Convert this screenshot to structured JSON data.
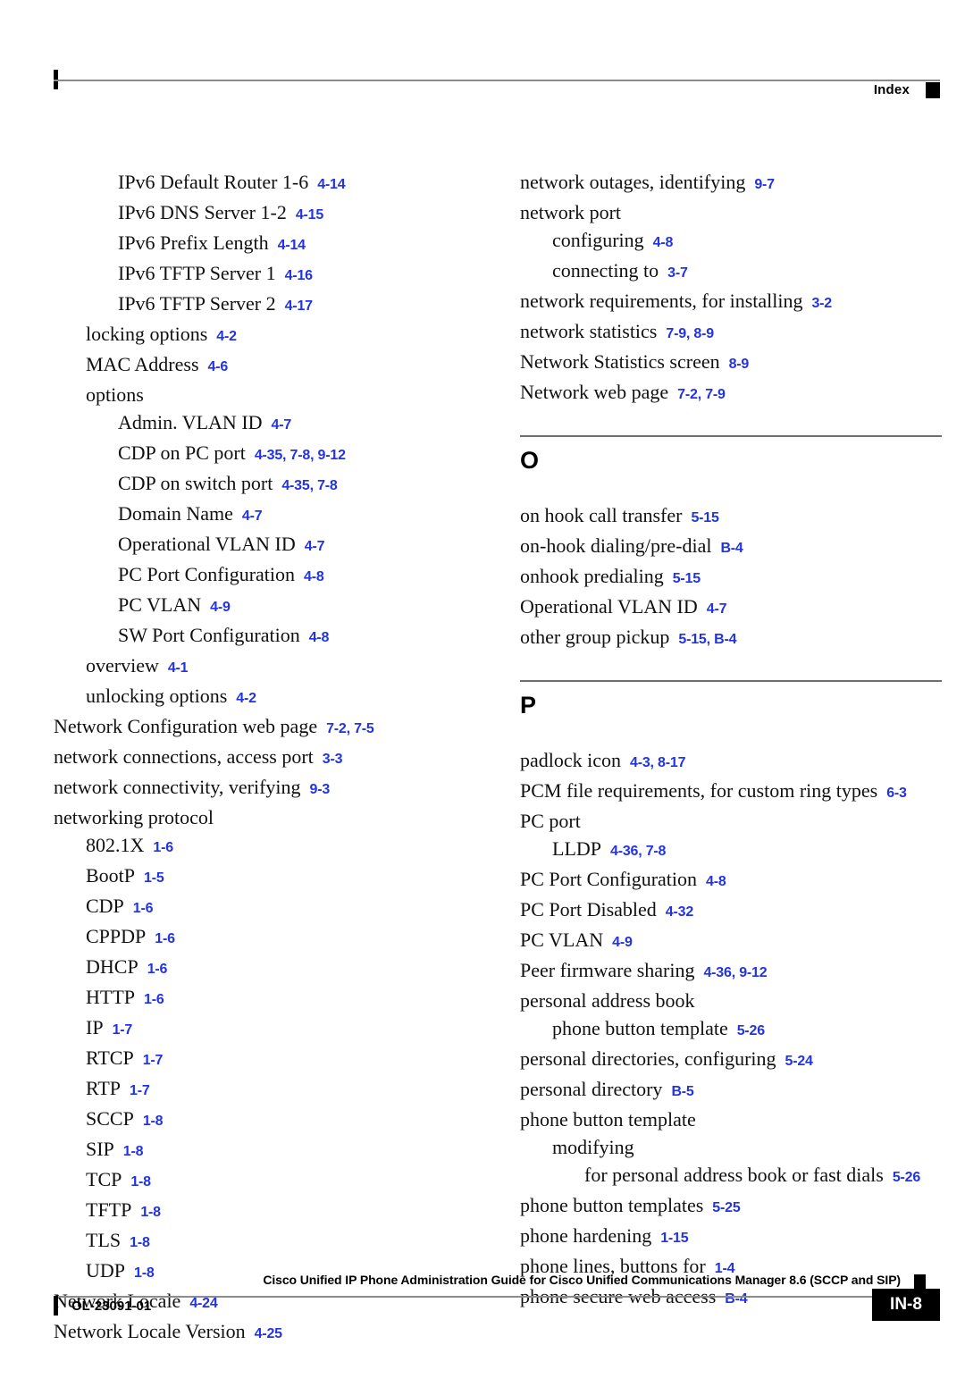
{
  "header": {
    "label": "Index",
    "marker_icon": "black-square-marker"
  },
  "accent_color": "#2233e6",
  "columns": {
    "left": [
      {
        "kind": "entry",
        "level": 2,
        "term": "IPv6 Default Router 1-6",
        "refs": "4-14"
      },
      {
        "kind": "entry",
        "level": 2,
        "term": "IPv6 DNS Server 1-2",
        "refs": "4-15"
      },
      {
        "kind": "entry",
        "level": 2,
        "term": "IPv6 Prefix Length",
        "refs": "4-14"
      },
      {
        "kind": "entry",
        "level": 2,
        "term": "IPv6 TFTP Server 1",
        "refs": "4-16"
      },
      {
        "kind": "entry",
        "level": 2,
        "term": "IPv6 TFTP Server 2",
        "refs": "4-17"
      },
      {
        "kind": "entry",
        "level": 1,
        "term": "locking options",
        "refs": "4-2"
      },
      {
        "kind": "entry",
        "level": 1,
        "term": "MAC Address",
        "refs": "4-6"
      },
      {
        "kind": "entry",
        "level": 1,
        "term": "options",
        "refs": ""
      },
      {
        "kind": "entry",
        "level": 2,
        "term": "Admin. VLAN ID",
        "refs": "4-7"
      },
      {
        "kind": "entry",
        "level": 2,
        "term": "CDP on PC port",
        "refs": "4-35, 7-8, 9-12"
      },
      {
        "kind": "entry",
        "level": 2,
        "term": "CDP on switch port",
        "refs": "4-35, 7-8"
      },
      {
        "kind": "entry",
        "level": 2,
        "term": "Domain Name",
        "refs": "4-7"
      },
      {
        "kind": "entry",
        "level": 2,
        "term": "Operational VLAN ID",
        "refs": "4-7"
      },
      {
        "kind": "entry",
        "level": 2,
        "term": "PC Port Configuration",
        "refs": "4-8"
      },
      {
        "kind": "entry",
        "level": 2,
        "term": "PC VLAN",
        "refs": "4-9"
      },
      {
        "kind": "entry",
        "level": 2,
        "term": "SW Port Configuration",
        "refs": "4-8"
      },
      {
        "kind": "entry",
        "level": 1,
        "term": "overview",
        "refs": "4-1"
      },
      {
        "kind": "entry",
        "level": 1,
        "term": "unlocking options",
        "refs": "4-2"
      },
      {
        "kind": "entry",
        "level": 0,
        "term": "Network Configuration web page",
        "refs": "7-2, 7-5"
      },
      {
        "kind": "entry",
        "level": 0,
        "term": "network connections, access port",
        "refs": "3-3"
      },
      {
        "kind": "entry",
        "level": 0,
        "term": "network connectivity, verifying",
        "refs": "9-3"
      },
      {
        "kind": "entry",
        "level": 0,
        "term": "networking protocol",
        "refs": ""
      },
      {
        "kind": "entry",
        "level": 1,
        "term": "802.1X",
        "refs": "1-6"
      },
      {
        "kind": "entry",
        "level": 1,
        "term": "BootP",
        "refs": "1-5"
      },
      {
        "kind": "entry",
        "level": 1,
        "term": "CDP",
        "refs": "1-6"
      },
      {
        "kind": "entry",
        "level": 1,
        "term": "CPPDP",
        "refs": "1-6"
      },
      {
        "kind": "entry",
        "level": 1,
        "term": "DHCP",
        "refs": "1-6"
      },
      {
        "kind": "entry",
        "level": 1,
        "term": "HTTP",
        "refs": "1-6"
      },
      {
        "kind": "entry",
        "level": 1,
        "term": "IP",
        "refs": "1-7"
      },
      {
        "kind": "entry",
        "level": 1,
        "term": "RTCP",
        "refs": "1-7"
      },
      {
        "kind": "entry",
        "level": 1,
        "term": "RTP",
        "refs": "1-7"
      },
      {
        "kind": "entry",
        "level": 1,
        "term": "SCCP",
        "refs": "1-8"
      },
      {
        "kind": "entry",
        "level": 1,
        "term": "SIP",
        "refs": "1-8"
      },
      {
        "kind": "entry",
        "level": 1,
        "term": "TCP",
        "refs": "1-8"
      },
      {
        "kind": "entry",
        "level": 1,
        "term": "TFTP",
        "refs": "1-8"
      },
      {
        "kind": "entry",
        "level": 1,
        "term": "TLS",
        "refs": "1-8"
      },
      {
        "kind": "entry",
        "level": 1,
        "term": "UDP",
        "refs": "1-8"
      },
      {
        "kind": "entry",
        "level": 0,
        "term": "Network Locale",
        "refs": "4-24"
      },
      {
        "kind": "entry",
        "level": 0,
        "term": "Network Locale Version",
        "refs": "4-25"
      }
    ],
    "right": [
      {
        "kind": "entry",
        "level": 0,
        "term": "network outages, identifying",
        "refs": "9-7"
      },
      {
        "kind": "entry",
        "level": 0,
        "term": "network port",
        "refs": ""
      },
      {
        "kind": "entry",
        "level": 1,
        "term": "configuring",
        "refs": "4-8"
      },
      {
        "kind": "entry",
        "level": 1,
        "term": "connecting to",
        "refs": "3-7"
      },
      {
        "kind": "entry",
        "level": 0,
        "term": "network requirements, for installing",
        "refs": "3-2"
      },
      {
        "kind": "entry",
        "level": 0,
        "term": "network statistics",
        "refs": "7-9, 8-9"
      },
      {
        "kind": "entry",
        "level": 0,
        "term": "Network Statistics screen",
        "refs": "8-9"
      },
      {
        "kind": "entry",
        "level": 0,
        "term": "Network web page",
        "refs": "7-2, 7-9"
      },
      {
        "kind": "section",
        "letter": "O"
      },
      {
        "kind": "entry",
        "level": 0,
        "term": "on hook call transfer",
        "refs": "5-15"
      },
      {
        "kind": "entry",
        "level": 0,
        "term": "on-hook dialing/pre-dial",
        "refs": "B-4"
      },
      {
        "kind": "entry",
        "level": 0,
        "term": "onhook predialing",
        "refs": "5-15"
      },
      {
        "kind": "entry",
        "level": 0,
        "term": "Operational VLAN ID",
        "refs": "4-7"
      },
      {
        "kind": "entry",
        "level": 0,
        "term": "other group pickup",
        "refs": "5-15, B-4"
      },
      {
        "kind": "section",
        "letter": "P"
      },
      {
        "kind": "entry",
        "level": 0,
        "term": "padlock icon",
        "refs": "4-3, 8-17"
      },
      {
        "kind": "entry",
        "level": 0,
        "term": "PCM file requirements, for custom ring types",
        "refs": "6-3"
      },
      {
        "kind": "entry",
        "level": 0,
        "term": "PC port",
        "refs": ""
      },
      {
        "kind": "entry",
        "level": 1,
        "term": "LLDP",
        "refs": "4-36, 7-8"
      },
      {
        "kind": "entry",
        "level": 0,
        "term": "PC Port Configuration",
        "refs": "4-8"
      },
      {
        "kind": "entry",
        "level": 0,
        "term": "PC Port Disabled",
        "refs": "4-32"
      },
      {
        "kind": "entry",
        "level": 0,
        "term": "PC VLAN",
        "refs": "4-9"
      },
      {
        "kind": "entry",
        "level": 0,
        "term": "Peer firmware sharing",
        "refs": "4-36, 9-12"
      },
      {
        "kind": "entry",
        "level": 0,
        "term": "personal address book",
        "refs": ""
      },
      {
        "kind": "entry",
        "level": 1,
        "term": "phone button template",
        "refs": "5-26"
      },
      {
        "kind": "entry",
        "level": 0,
        "term": "personal directories, configuring",
        "refs": "5-24"
      },
      {
        "kind": "entry",
        "level": 0,
        "term": "personal directory",
        "refs": "B-5"
      },
      {
        "kind": "entry",
        "level": 0,
        "term": "phone button template",
        "refs": ""
      },
      {
        "kind": "entry",
        "level": 1,
        "term": "modifying",
        "refs": ""
      },
      {
        "kind": "entry",
        "level": 2,
        "term": "for personal address book or fast dials",
        "refs": "5-26"
      },
      {
        "kind": "entry",
        "level": 0,
        "term": "phone button templates",
        "refs": "5-25"
      },
      {
        "kind": "entry",
        "level": 0,
        "term": "phone hardening",
        "refs": "1-15"
      },
      {
        "kind": "entry",
        "level": 0,
        "term": "phone lines, buttons for",
        "refs": "1-4"
      },
      {
        "kind": "entry",
        "level": 0,
        "term": "phone secure web access",
        "refs": "B-4"
      }
    ]
  },
  "footer": {
    "title": "Cisco Unified IP Phone Administration Guide for Cisco Unified Communications Manager 8.6 (SCCP and SIP)",
    "doc_number": "OL-23091-01",
    "page_number": "IN-8",
    "marker_icon": "black-square-marker"
  }
}
